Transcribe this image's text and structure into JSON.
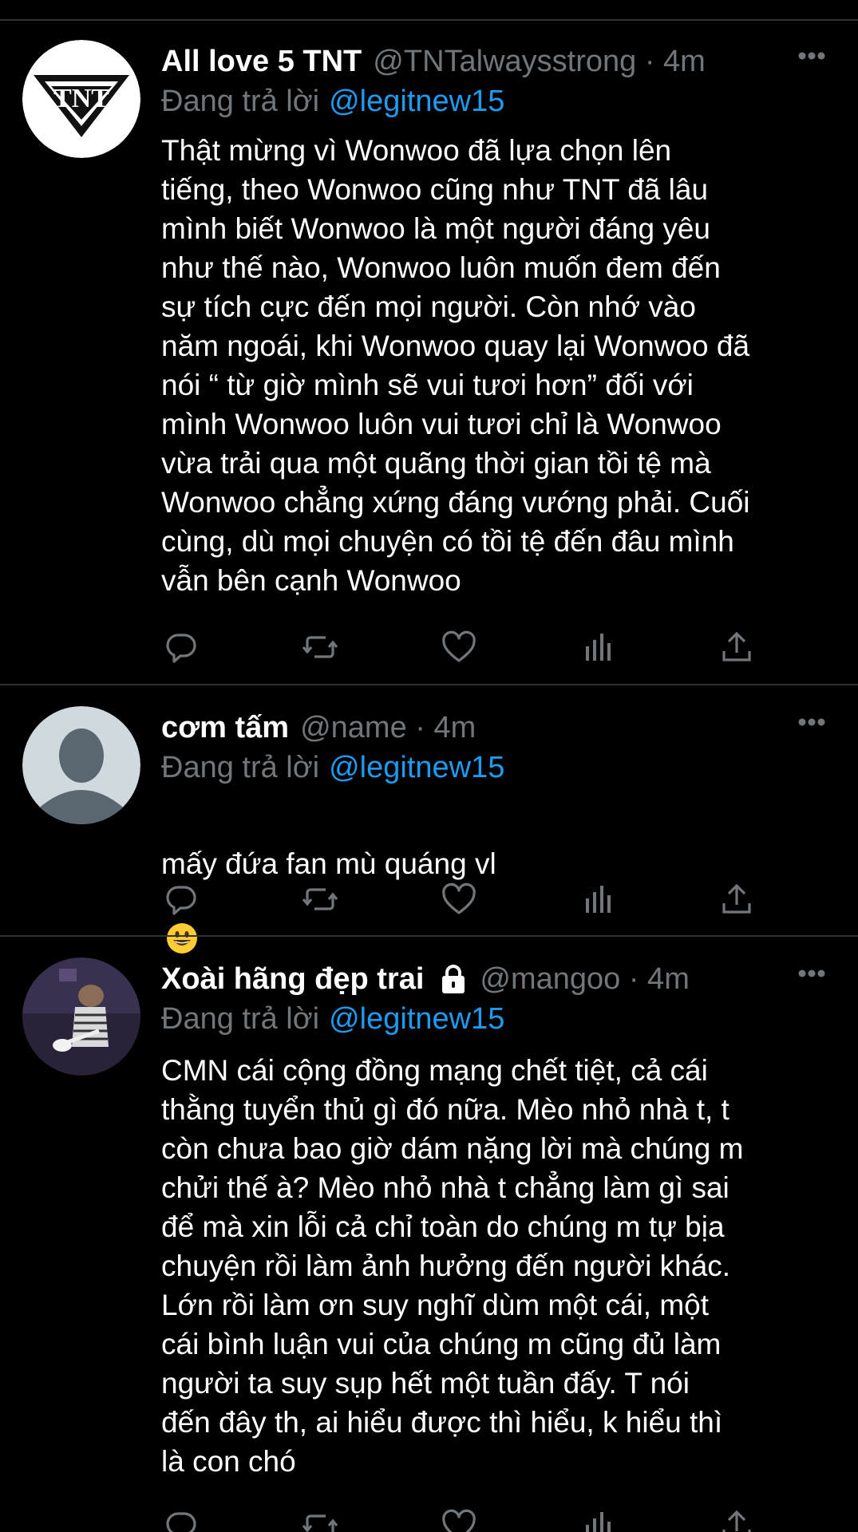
{
  "tweets": [
    {
      "display_name": "All love 5 TNT",
      "handle_meta": "@TNTalwaysstrong · 4m",
      "reply_prefix": "Đang trả lời",
      "reply_mention": "@legitnew15",
      "avatar_icon": "tnt-logo-avatar",
      "text": "Thật mừng vì Wonwoo đã lựa chọn lên\ntiếng, theo Wonwoo cũng như TNT đã lâu\nmình biết Wonwoo là một người đáng yêu\nnhư thế nào, Wonwoo luôn muốn đem đến\nsự tích cực đến mọi người. Còn nhớ vào\nnăm ngoái, khi Wonwoo quay lại Wonwoo đã\nnói “ từ giờ mình sẽ vui tươi hơn” đối với\nmình Wonwoo luôn vui tươi chỉ là Wonwoo\nvừa trải qua một quãng thời gian tồi tệ mà\nWonwoo chẳng xứng đáng vướng phải. Cuối\ncùng, dù mọi chuyện có tồi tệ đến đâu mình\nvẫn bên cạnh Wonwoo"
    },
    {
      "display_name": "cơm tấm",
      "handle_meta": "@name · 4m",
      "reply_prefix": "Đang trả lời",
      "reply_mention": "@legitnew15",
      "avatar_icon": "default-user-avatar",
      "text": "mấy đứa fan mù quáng vl",
      "emoji": "grinning-face-emoji"
    },
    {
      "display_name": "Xoài hãng đẹp trai",
      "handle_meta": "@mangoo · 4m",
      "reply_prefix": "Đang trả lời",
      "reply_mention": "@legitnew15",
      "avatar_icon": "cat-guitar-avatar",
      "protected_icon": "lock-icon",
      "text": "CMN cái cộng đồng mạng chết tiệt, cả cái\nthằng tuyển thủ gì đó nữa. Mèo nhỏ nhà t, t\ncòn chưa bao giờ dám nặng lời mà chúng m\nchửi thế à? Mèo nhỏ nhà t chẳng làm gì sai\nđể mà xin lỗi cả chỉ toàn do chúng m tự bịa\nchuyện rồi làm ảnh hưởng đến người khác.\nLớn rồi làm ơn suy nghĩ dùm một cái, một\ncái bình luận vui của chúng m cũng đủ làm\nngười ta suy sụp hết một tuần đấy. T nói\nđến đây th, ai hiểu được thì hiểu, k hiểu thì\nlà con chó"
    }
  ],
  "action_icons": [
    "reply-icon",
    "retweet-icon",
    "like-icon",
    "analytics-icon",
    "share-icon"
  ],
  "colors": {
    "background": "#000000",
    "text": "#ffffff",
    "secondary": "#71767b",
    "mention": "#1d9bf0",
    "divider": "#2f3336"
  }
}
